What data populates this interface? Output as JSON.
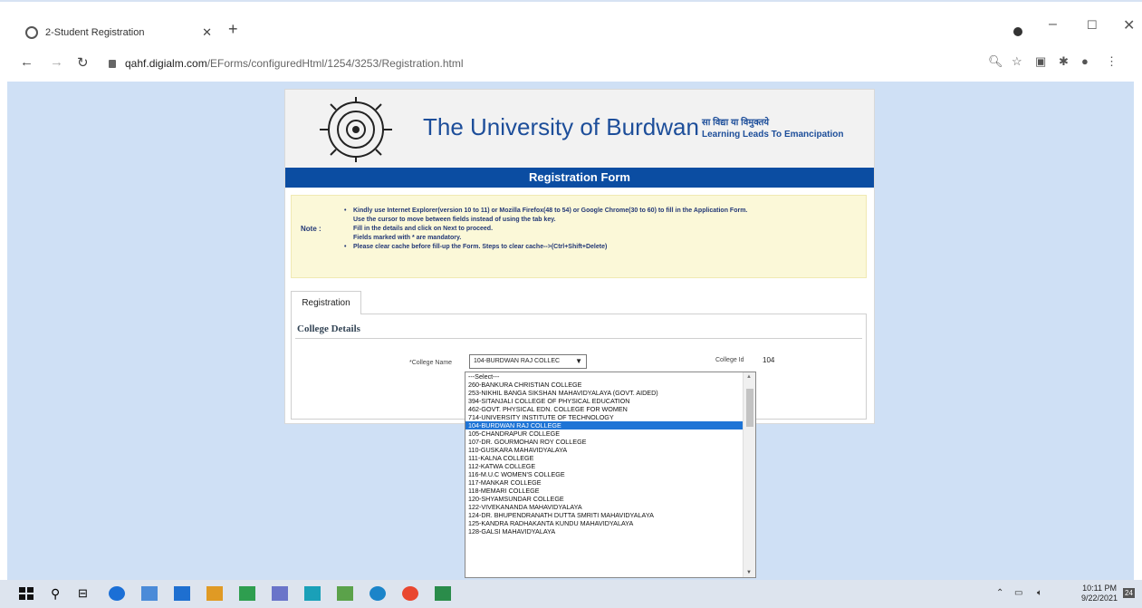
{
  "browser": {
    "tab_title": "2-Student Registration",
    "url_host": "qahf.digialm.com",
    "url_path": "/EForms/configuredHtml/1254/3253/Registration.html"
  },
  "header": {
    "university_name": "The University of Burdwan",
    "motto_hindi": "सा विद्या या विमुक्तये",
    "motto_english": "Learning Leads To Emancipation",
    "form_title": "Registration Form"
  },
  "note": {
    "label": "Note :",
    "lines": [
      "Kindly use Internet Explorer(version 10 to 11) or Mozilla Firefox(48 to 54) or Google Chrome(30 to 60) to fill in the Application Form.",
      "Use the cursor to move between fields instead of using the tab key.",
      "Fill in the details and click on Next to proceed.",
      "Fields marked with * are mandatory.",
      "Please clear cache before fill-up the Form. Steps to clear cache-->(Ctrl+Shift+Delete)"
    ]
  },
  "tabs": {
    "registration": "Registration"
  },
  "college": {
    "section_title": "College Details",
    "name_label": "*College Name",
    "selected_value": "104-BURDWAN RAJ COLLEC",
    "id_label": "College Id",
    "id_value": "104"
  },
  "dropdown_options": [
    "---Select---",
    "260-BANKURA CHRISTIAN COLLEGE",
    "253-NIKHIL BANGA SIKSHAN MAHAVIDYALAYA (GOVT. AIDED)",
    "394-SITANJALI COLLEGE OF PHYSICAL EDUCATION",
    "462-GOVT. PHYSICAL EDN. COLLEGE FOR WOMEN",
    "714-UNIVERSITY INSTITUTE OF TECHNOLOGY",
    "104-BURDWAN RAJ COLLEGE",
    "105-CHANDRAPUR COLLEGE",
    "107-DR. GOURMOHAN ROY COLLEGE",
    "110-GUSKARA MAHAVIDYALAYA",
    "111-KALNA COLLEGE",
    "112-KATWA COLLEGE",
    "116-M.U.C WOMEN'S COLLEGE",
    "117-MANKAR COLLEGE",
    "118-MEMARI COLLEGE",
    "120-SHYAMSUNDAR COLLEGE",
    "122-VIVEKANANDA MAHAVIDYALAYA",
    "124-DR. BHUPENDRANATH DUTTA SMRITI MAHAVIDYALAYA",
    "125-KANDRA RADHAKANTA KUNDU MAHAVIDYALAYA",
    "128-GALSI MAHAVIDYALAYA"
  ],
  "selected_option": "104-BURDWAN RAJ COLLEGE",
  "taskbar": {
    "time": "10:11 PM",
    "date": "9/22/2021",
    "notification_count": "24"
  },
  "colors": {
    "page_bg": "#cfe0f5",
    "form_bar": "#0b4da2",
    "note_bg": "#fbf8d8",
    "selection": "#1e74d6"
  }
}
